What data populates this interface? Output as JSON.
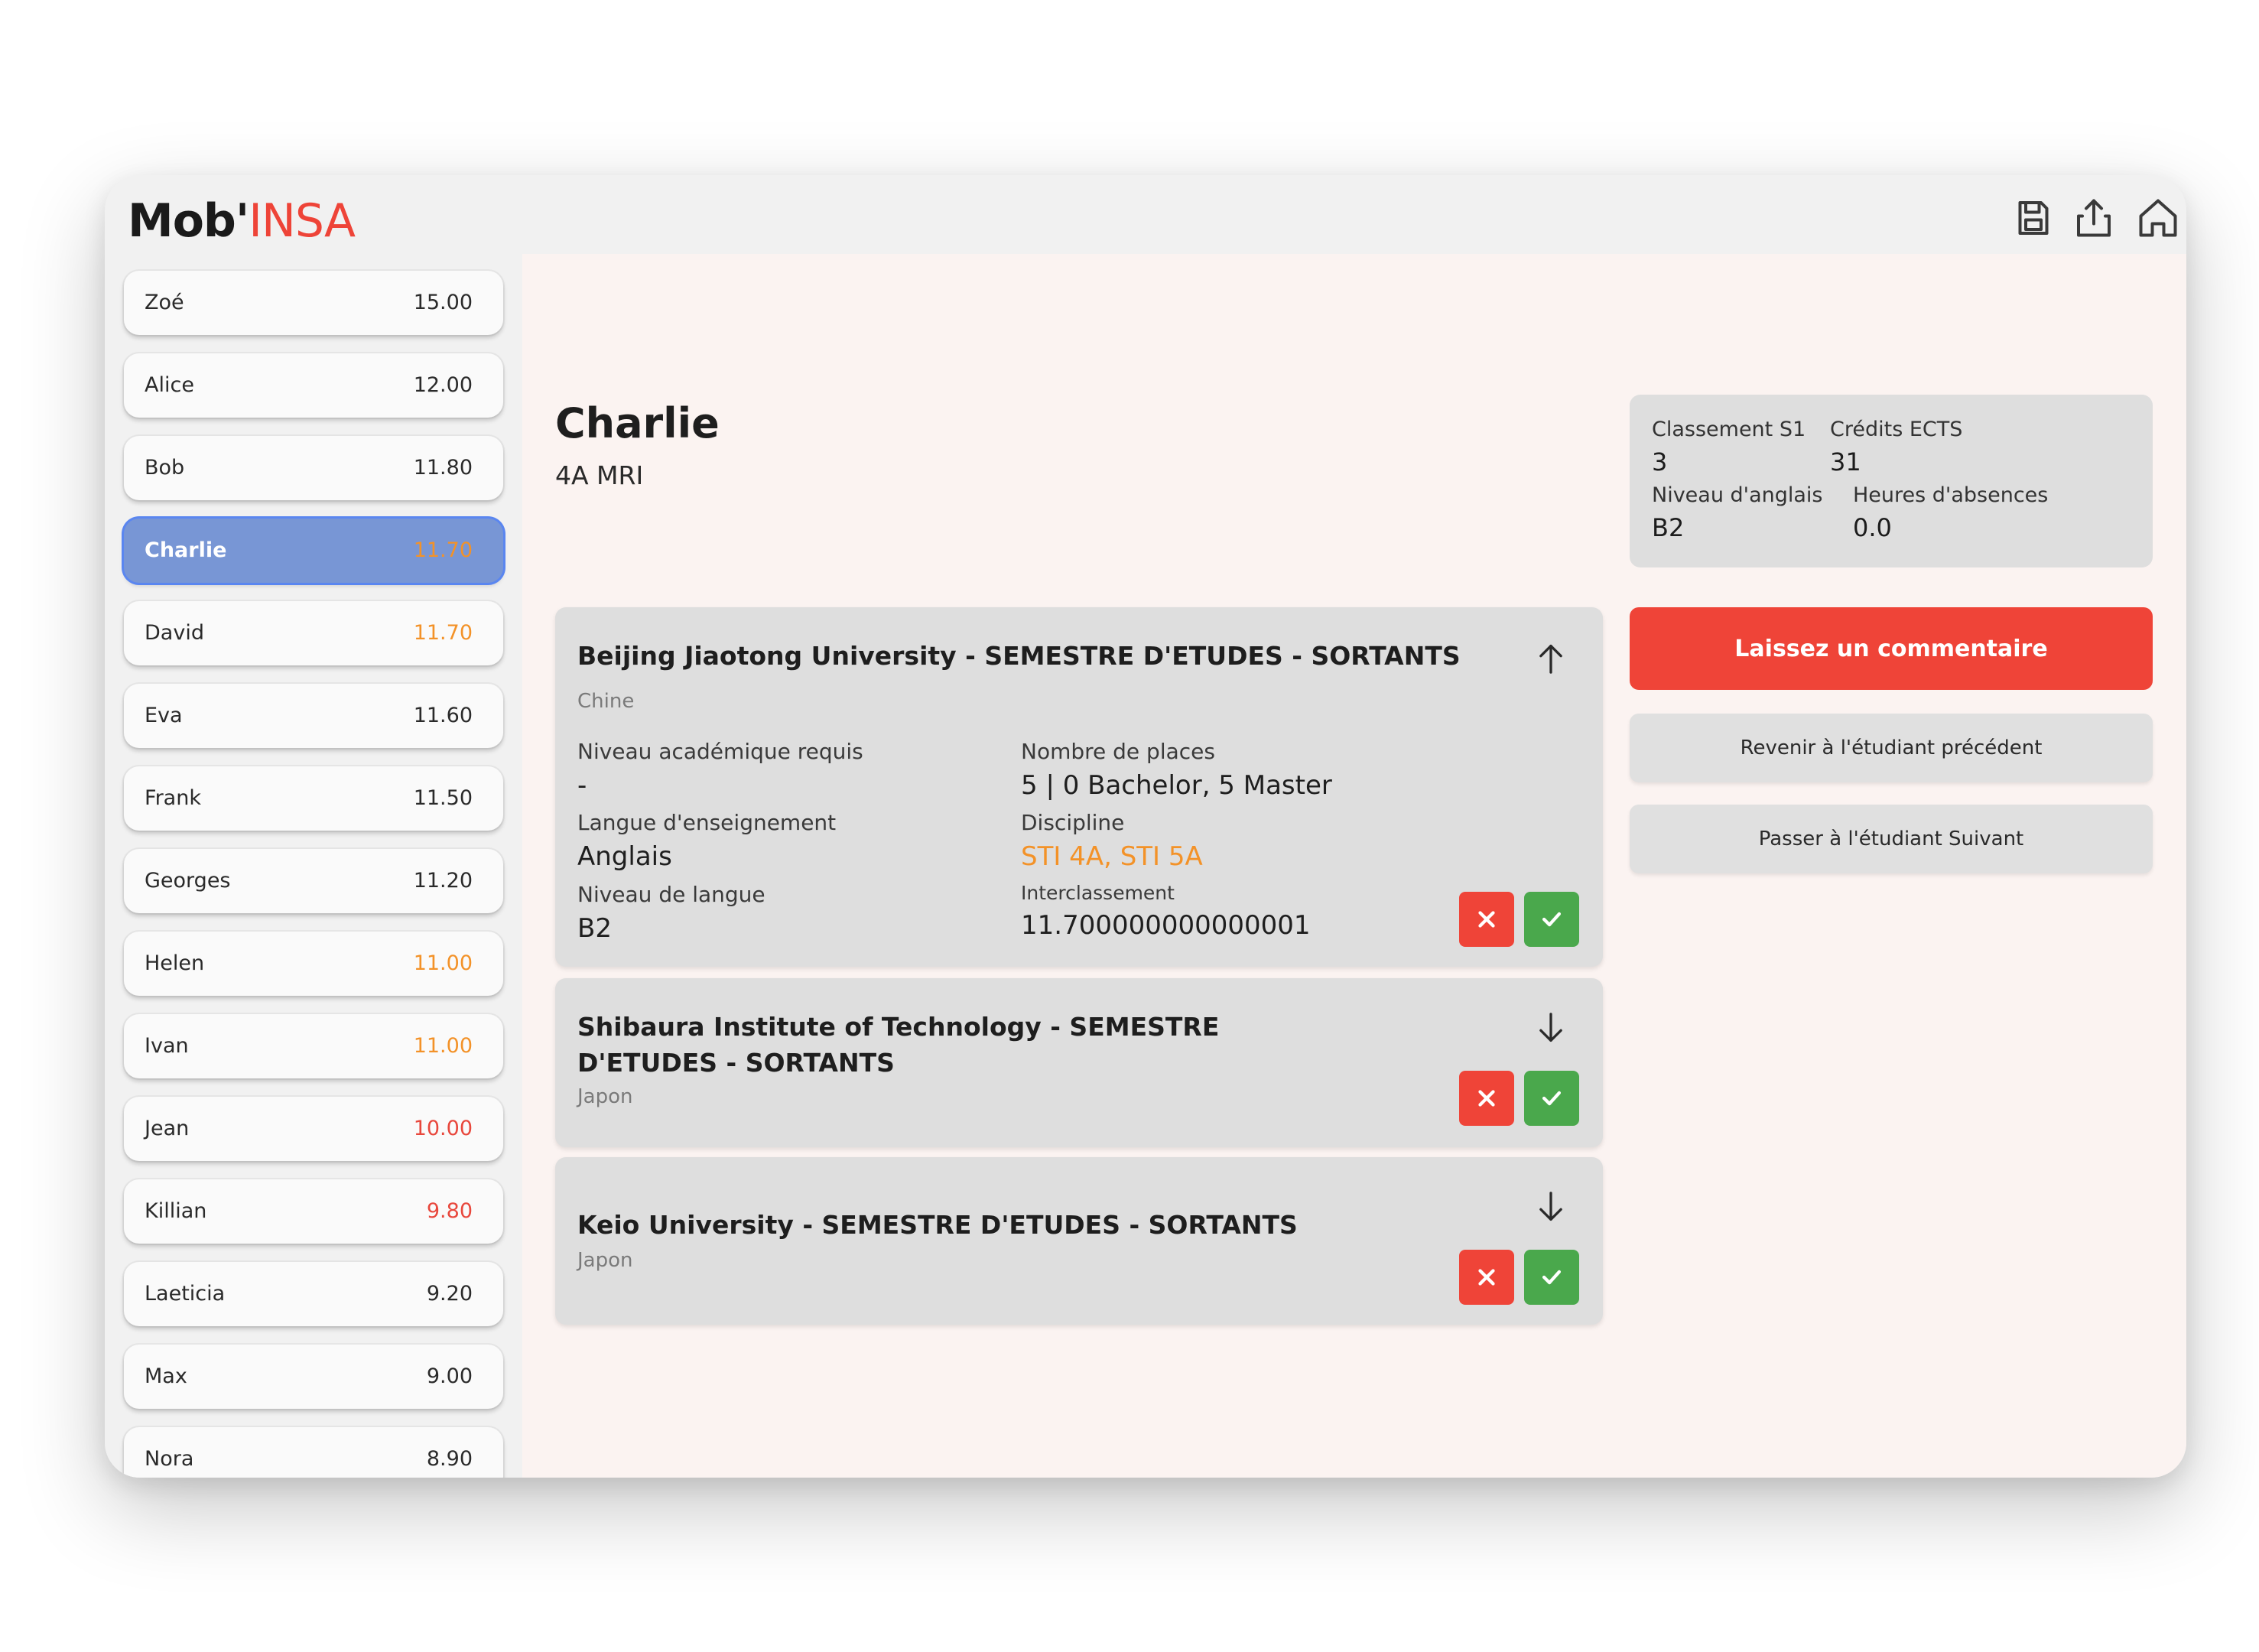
{
  "app": {
    "logo_main": "Mob'",
    "logo_accent": "INSA"
  },
  "toolbar": {
    "icons": [
      "save-icon",
      "share-icon",
      "home-icon"
    ]
  },
  "colors": {
    "accent_red": "#ef4438",
    "selected_blue": "#7896d5",
    "score_orange": "#f39228",
    "score_red": "#e8473c",
    "accept_green": "#4aa84c"
  },
  "students": [
    {
      "name": "Zoé",
      "score": "15.00",
      "status": "normal"
    },
    {
      "name": "Alice",
      "score": "12.00",
      "status": "normal"
    },
    {
      "name": "Bob",
      "score": "11.80",
      "status": "normal"
    },
    {
      "name": "Charlie",
      "score": "11.70",
      "status": "warning",
      "selected": true
    },
    {
      "name": "David",
      "score": "11.70",
      "status": "warning"
    },
    {
      "name": "Eva",
      "score": "11.60",
      "status": "normal"
    },
    {
      "name": "Frank",
      "score": "11.50",
      "status": "normal"
    },
    {
      "name": "Georges",
      "score": "11.20",
      "status": "normal"
    },
    {
      "name": "Helen",
      "score": "11.00",
      "status": "warning"
    },
    {
      "name": "Ivan",
      "score": "11.00",
      "status": "warning"
    },
    {
      "name": "Jean",
      "score": "10.00",
      "status": "danger"
    },
    {
      "name": "Killian",
      "score": "9.80",
      "status": "danger"
    },
    {
      "name": "Laeticia",
      "score": "9.20",
      "status": "normal"
    },
    {
      "name": "Max",
      "score": "9.00",
      "status": "normal"
    },
    {
      "name": "Nora",
      "score": "8.90",
      "status": "normal"
    }
  ],
  "student": {
    "name": "Charlie",
    "class": "4A MRI"
  },
  "stats": {
    "classement_label": "Classement S1",
    "classement_value": "3",
    "credits_label": "Crédits ECTS",
    "credits_value": "31",
    "anglais_label": "Niveau d'anglais",
    "anglais_value": "B2",
    "absences_label": "Heures d'absences",
    "absences_value": "0.0"
  },
  "actions": {
    "comment": "Laissez un commentaire",
    "previous": "Revenir à l'étudiant précédent",
    "next": "Passer à l'étudiant Suivant"
  },
  "universities": [
    {
      "title": "Beijing Jiaotong University - SEMESTRE D'ETUDES - SORTANTS",
      "country": "Chine",
      "expanded": true,
      "fields": {
        "niveau_label": "Niveau académique requis",
        "niveau_value": "-",
        "places_label": "Nombre de places",
        "places_value": "5 | 0 Bachelor, 5 Master",
        "langue_label": "Langue d'enseignement",
        "langue_value": "Anglais",
        "discipline_label": "Discipline",
        "discipline_value": "STI 4A, STI 5A",
        "niveau_langue_label": "Niveau de langue",
        "niveau_langue_value": "B2",
        "interclassement_label": "Interclassement",
        "interclassement_value": "11.700000000000001"
      }
    },
    {
      "title_line1": "Shibaura Institute of Technology - SEMESTRE",
      "title_line2": "D'ETUDES - SORTANTS",
      "country": "Japon",
      "expanded": false
    },
    {
      "title": "Keio University - SEMESTRE D'ETUDES - SORTANTS",
      "country": "Japon",
      "expanded": false
    }
  ]
}
